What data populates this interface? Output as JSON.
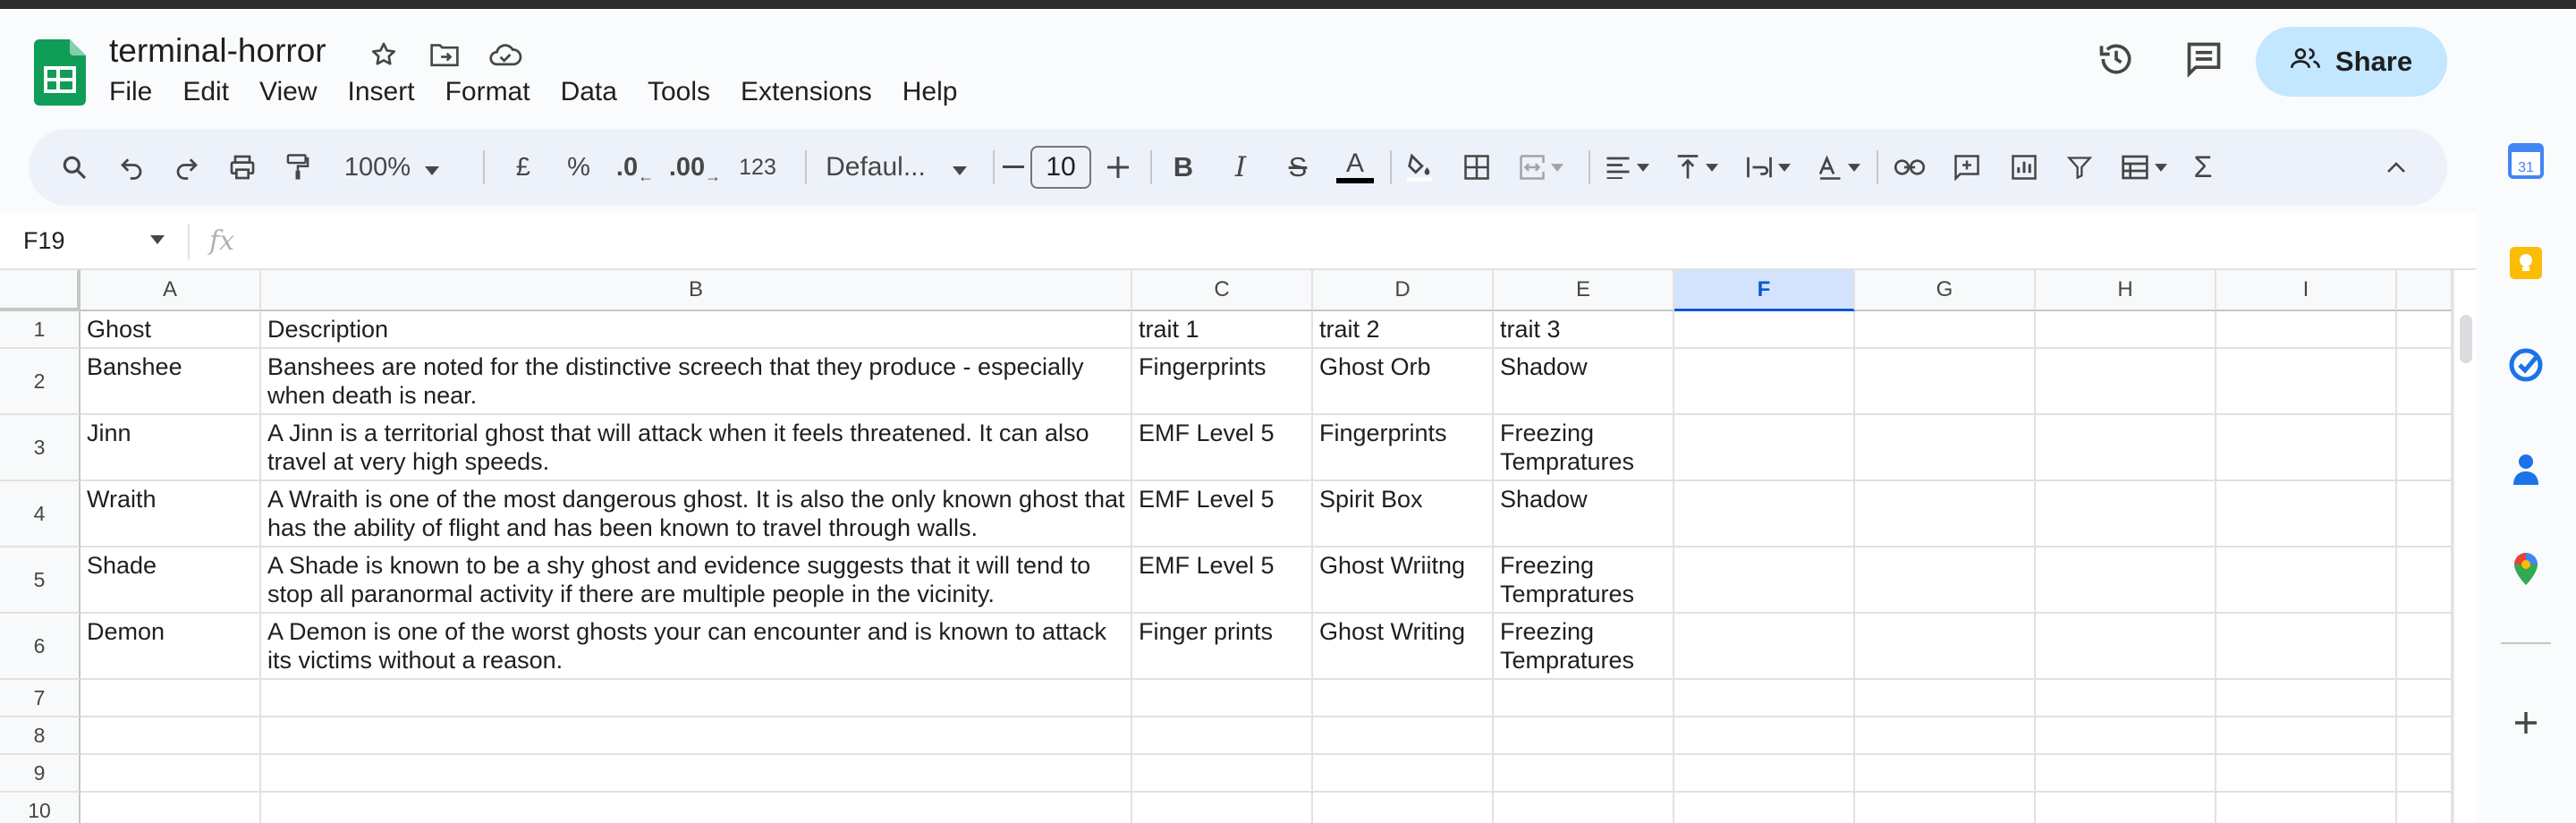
{
  "document": {
    "title": "terminal-horror"
  },
  "menu": [
    "File",
    "Edit",
    "View",
    "Insert",
    "Format",
    "Data",
    "Tools",
    "Extensions",
    "Help"
  ],
  "header": {
    "share_label": "Share"
  },
  "toolbar": {
    "zoom": "100%",
    "currency": "£",
    "percent": "%",
    "decrease_decimal": ".0",
    "increase_decimal": ".00",
    "number_format": "123",
    "font": "Defaul...",
    "font_size": "10"
  },
  "formula_bar": {
    "cell_ref": "F19",
    "fx": "fx"
  },
  "grid": {
    "columns": [
      "A",
      "B",
      "C",
      "D",
      "E",
      "F",
      "G",
      "H",
      "I"
    ],
    "selected_column": "F",
    "row_numbers": [
      "1",
      "2",
      "3",
      "4",
      "5",
      "6",
      "7",
      "8",
      "9",
      "10"
    ],
    "rows": [
      [
        "Ghost",
        "Description",
        "trait 1",
        "trait 2",
        "trait 3"
      ],
      [
        "Banshee",
        "Banshees are noted for the distinctive screech that they produce - especially when death is near.",
        "Fingerprints",
        "Ghost Orb",
        "Shadow"
      ],
      [
        "Jinn",
        "A Jinn is a territorial ghost that will attack when it feels threatened. It can also travel at very high speeds.",
        "EMF Level 5",
        "Fingerprints",
        "Freezing Tempratures"
      ],
      [
        "Wraith",
        "A Wraith is one of the most dangerous ghost. It is also the only known ghost that has the ability of flight and has been known to travel through walls.",
        "EMF Level 5",
        "Spirit Box",
        "Shadow"
      ],
      [
        "Shade",
        "A Shade is known to be a shy ghost and evidence suggests that it will tend to stop all paranormal activity if there are multiple people in the vicinity.",
        "EMF Level 5",
        "Ghost Wriitng",
        "Freezing Tempratures"
      ],
      [
        "Demon",
        "A Demon is one of the worst ghosts your can encounter and is known to attack its victims without a reason.",
        "Finger prints",
        "Ghost Writing",
        "Freezing Tempratures"
      ]
    ]
  },
  "side_panel": {
    "calendar_day": "31"
  },
  "colors": {
    "accent": "#0b57d0",
    "share_bg": "#c2e7ff",
    "sheets_green": "#0f9d58",
    "toolbar_bg": "#edf2fa"
  }
}
